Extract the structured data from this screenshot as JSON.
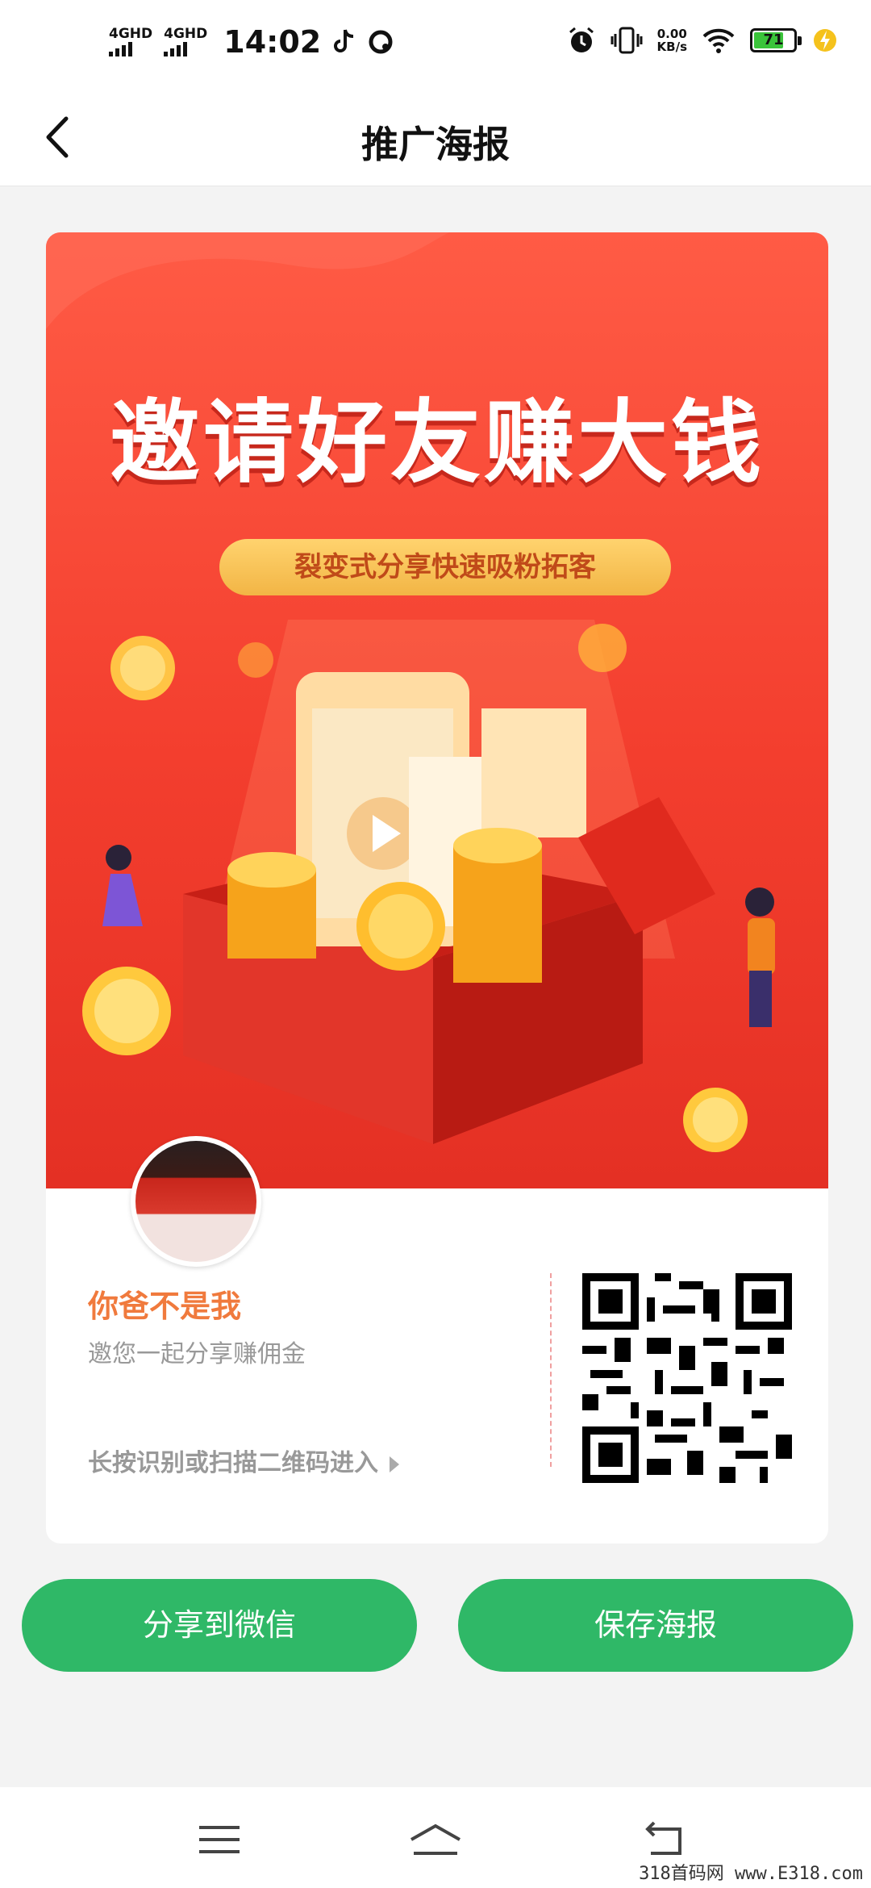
{
  "status_bar": {
    "network1": "4GHD",
    "network2": "4GHD",
    "time": "14:02",
    "speed_value": "0.00",
    "speed_unit": "KB/s",
    "battery": "71"
  },
  "header": {
    "title": "推广海报"
  },
  "poster": {
    "headline": "邀请好友赚大钱",
    "subtitle_pill": "裂变式分享快速吸粉拓客",
    "user_name": "你爸不是我",
    "invite_text": "邀您一起分享赚佣金",
    "scan_hint": "长按识别或扫描二维码进入"
  },
  "actions": {
    "share_wechat": "分享到微信",
    "save_poster": "保存海报"
  },
  "watermark": "318首码网 www.E318.com",
  "colors": {
    "accent_green": "#2fb867",
    "poster_red": "#f33e2e",
    "name_orange": "#f07a3d"
  }
}
